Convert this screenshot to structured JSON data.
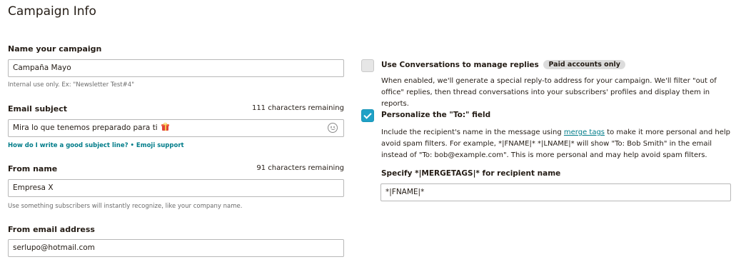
{
  "page_title": "Campaign Info",
  "campaign_name": {
    "label": "Name your campaign",
    "value": "Campaña Mayo",
    "help": "Internal use only. Ex: \"Newsletter Test#4\""
  },
  "email_subject": {
    "label": "Email subject",
    "remaining": "111 characters remaining",
    "value": "Mira lo que tenemos preparado para ti",
    "link_subject": "How do I write a good subject line?",
    "separator": "•",
    "link_emoji": "Emoji support",
    "emoji_icon": "smiley-face-icon",
    "value_emoji": "gift-icon"
  },
  "from_name": {
    "label": "From name",
    "remaining": "91 characters remaining",
    "value": "Empresa X",
    "help": "Use something subscribers will instantly recognize, like your company name."
  },
  "from_email": {
    "label": "From email address",
    "value": "serlupo@hotmail.com"
  },
  "conversations": {
    "checked": false,
    "label": "Use Conversations to manage replies",
    "badge": "Paid accounts only",
    "description": "When enabled, we'll generate a special reply-to address for your campaign. We'll filter \"out of office\" replies, then thread conversations into your subscribers' profiles and display them in reports."
  },
  "personalize_to": {
    "checked": true,
    "label": "Personalize the \"To:\" field",
    "desc_before": "Include the recipient's name in the message using ",
    "desc_link": "merge tags",
    "desc_after": " to make it more personal and help avoid spam filters. For example, *|FNAME|* *|LNAME|* will show \"To: Bob Smith\" in the email instead of \"To: bob@example.com\". This is more personal and may help avoid spam filters.",
    "mergetag_label": "Specify *|MERGETAGS|* for recipient name",
    "mergetag_value": "*|FNAME|*"
  },
  "colors": {
    "link": "#007c89",
    "checkbox_checked": "#1fa1c6",
    "badge_bg": "#dcdcdc"
  }
}
